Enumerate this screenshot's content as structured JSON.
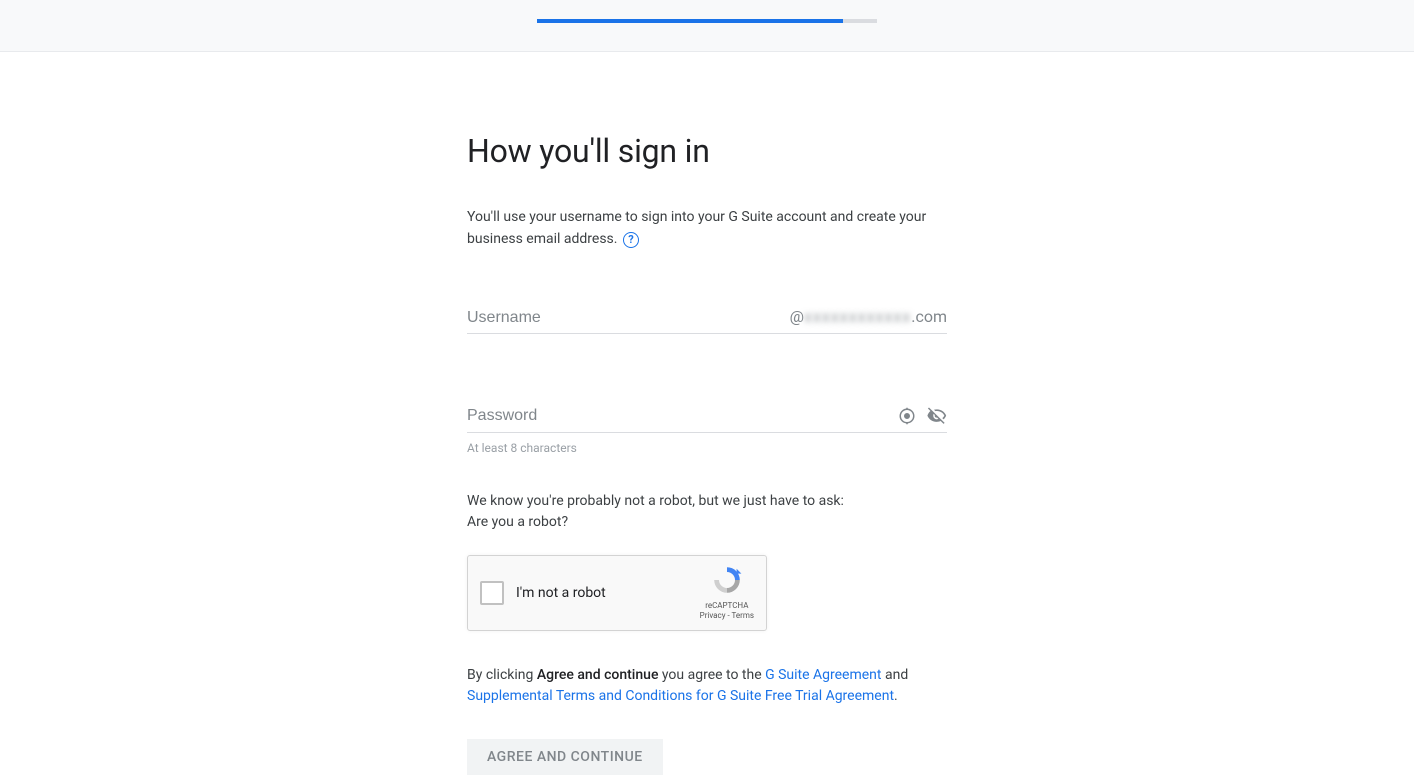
{
  "progress": {
    "percent": 90
  },
  "heading": "How you'll sign in",
  "subtitle_part1": "You'll use your username to sign into your G Suite account and create your business email address. ",
  "username": {
    "placeholder": "Username",
    "value": "",
    "domain_prefix": "@",
    "domain_blurred": "xxxxxxxxxxxx",
    "domain_suffix": ".com"
  },
  "password": {
    "placeholder": "Password",
    "value": "",
    "hint": "At least 8 characters"
  },
  "robot": {
    "line1": "We know you're probably not a robot, but we just have to ask:",
    "line2": "Are you a robot?"
  },
  "recaptcha": {
    "label": "I'm not a robot",
    "brand": "reCAPTCHA",
    "privacy": "Privacy",
    "terms": "Terms"
  },
  "agreement": {
    "prefix": "By clicking ",
    "bold": "Agree and continue",
    "middle": " you agree to the ",
    "link1": "G Suite Agreement",
    "between": " and ",
    "link2": "Supplemental Terms and Conditions for G Suite Free Trial Agreement",
    "suffix": "."
  },
  "submit_label": "Agree and Continue"
}
